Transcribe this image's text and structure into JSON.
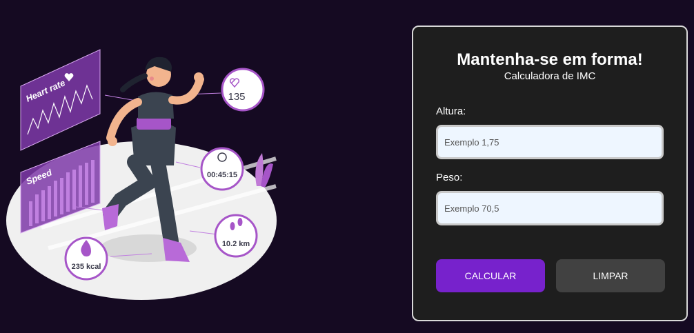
{
  "illustration": {
    "heart_rate_label": "Heart rate",
    "speed_label": "Speed",
    "heart_value": "135",
    "timer_value": "00:45:15",
    "distance_value": "10.2 km",
    "calories_value": "235 kcal"
  },
  "form": {
    "title": "Mantenha-se em forma!",
    "subtitle": "Calculadora de IMC",
    "height_label": "Altura:",
    "height_placeholder": "Exemplo 1,75",
    "weight_label": "Peso:",
    "weight_placeholder": "Exemplo 70,5",
    "calculate_label": "CALCULAR",
    "clear_label": "LIMPAR"
  },
  "colors": {
    "background": "#150a22",
    "card": "#1e1e1e",
    "accent": "#7722cc",
    "secondary_button": "#414141"
  }
}
